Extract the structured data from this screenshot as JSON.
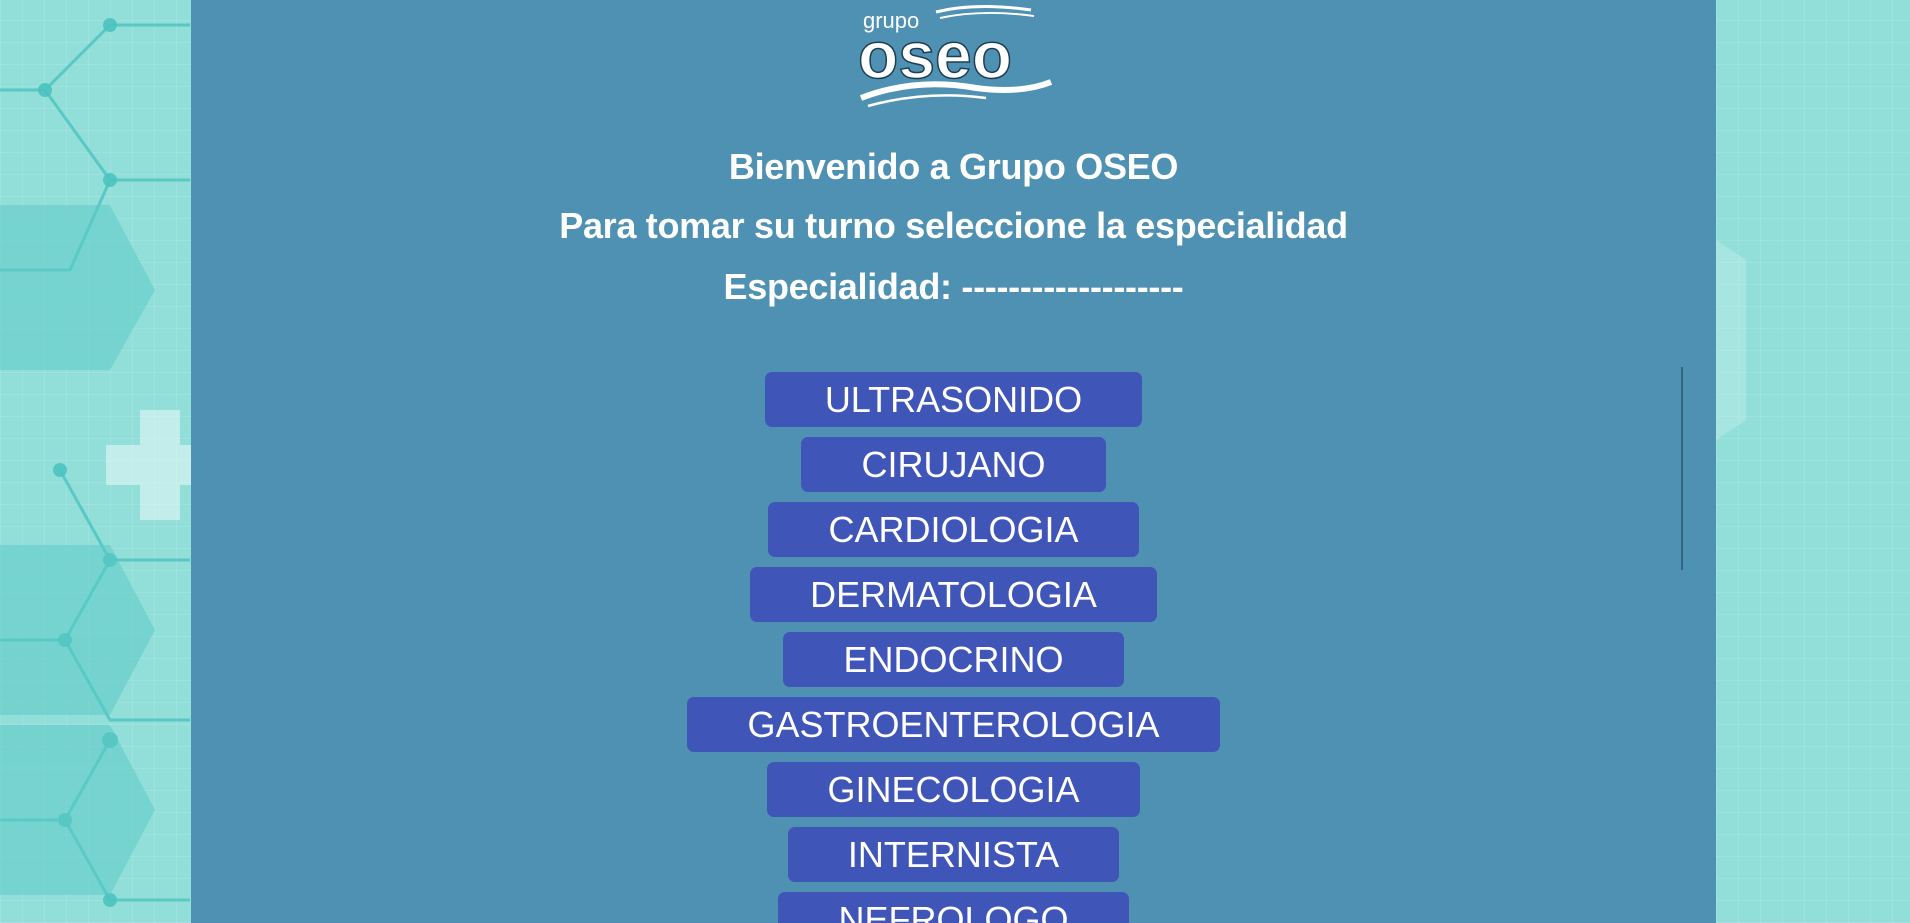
{
  "brand": {
    "logo_small": "grupo",
    "logo_main": "oseo"
  },
  "header": {
    "welcome": "Bienvenido a Grupo OSEO",
    "instruction": "Para tomar su turno seleccione la especialidad",
    "specialty_line": "Especialidad: -------------------"
  },
  "specialties": [
    "ULTRASONIDO",
    "CIRUJANO",
    "CARDIOLOGIA",
    "DERMATOLOGIA",
    "ENDOCRINO",
    "GASTROENTEROLOGIA",
    "GINECOLOGIA",
    "INTERNISTA",
    "NEFROLOGO"
  ],
  "colors": {
    "panel_background": "#4f91b3",
    "button_background": "#4055b8",
    "side_background": "#92dfda",
    "text": "#ffffff"
  }
}
